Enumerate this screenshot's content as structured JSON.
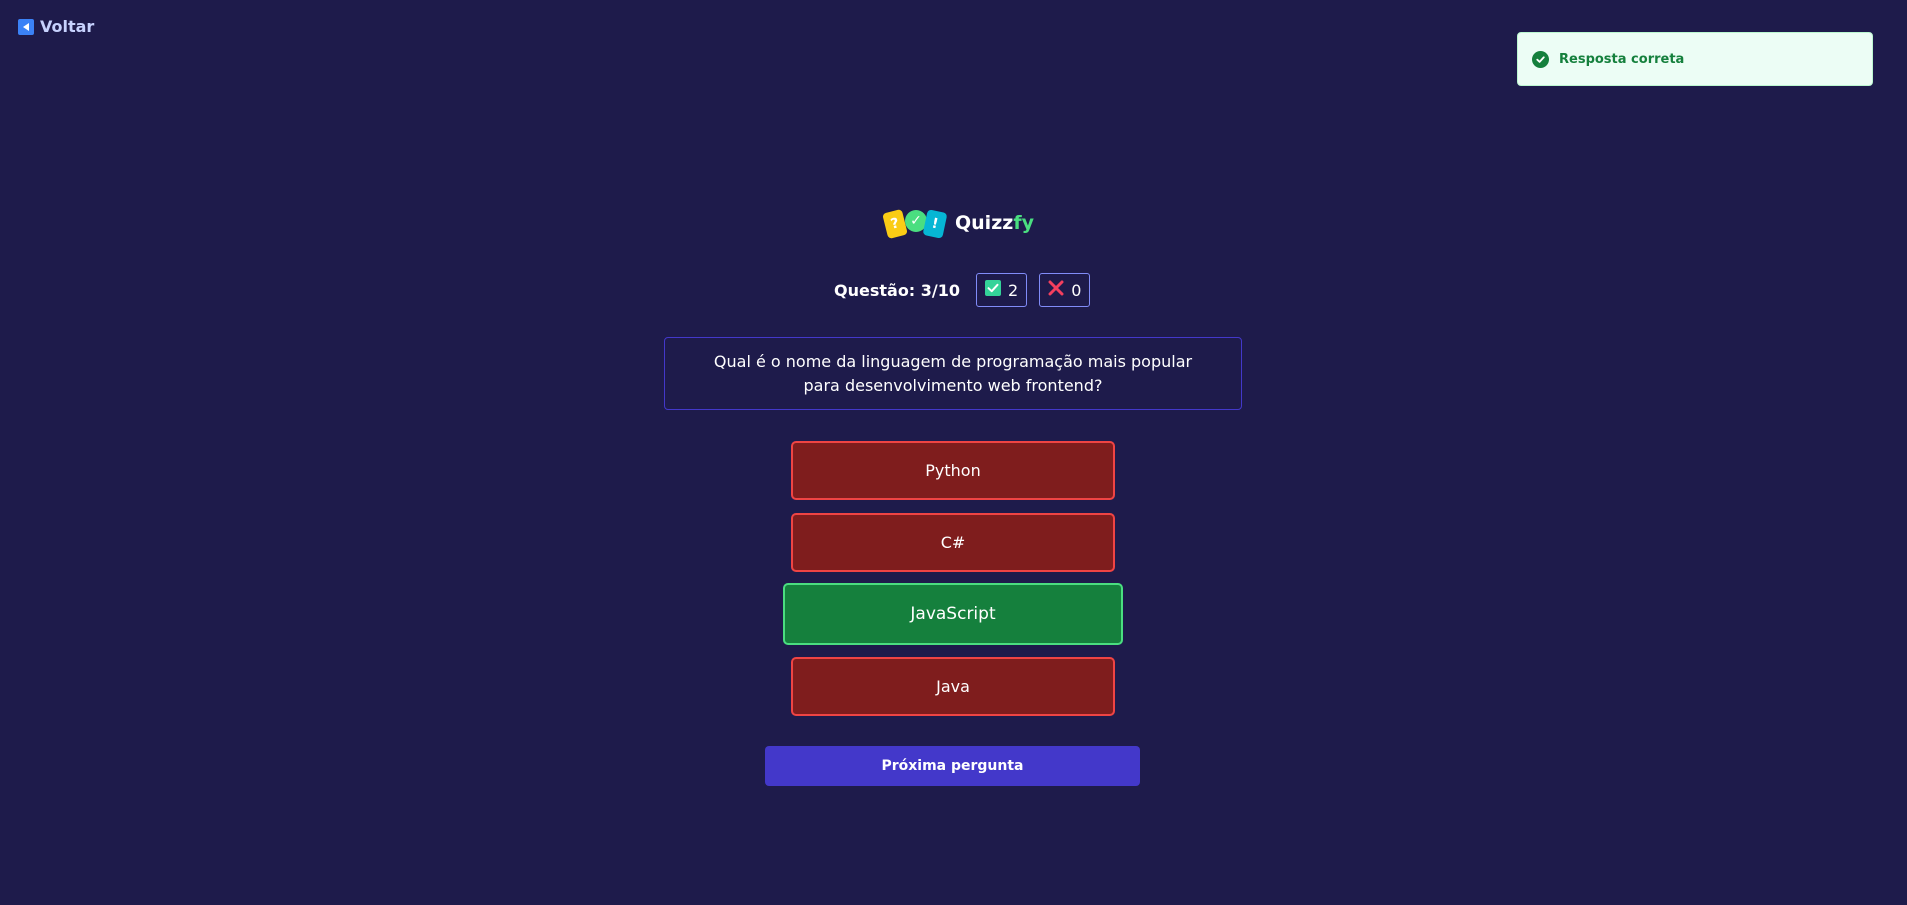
{
  "nav": {
    "back_label": "Voltar"
  },
  "toast": {
    "message": "Resposta correta",
    "icon": "check-circle-icon"
  },
  "logo": {
    "cards": [
      "?",
      "✓",
      "!"
    ],
    "name_main": "Quizz",
    "name_accent": "fy"
  },
  "stats": {
    "question_label": "Questão: 3/10",
    "correct_count": "2",
    "wrong_count": "0"
  },
  "question": {
    "text": "Qual é o nome da linguagem de programação mais popular para desenvolvimento web frontend?"
  },
  "answers": [
    {
      "label": "Python",
      "status": "wrong"
    },
    {
      "label": "C#",
      "status": "wrong"
    },
    {
      "label": "JavaScript",
      "status": "correct"
    },
    {
      "label": "Java",
      "status": "wrong"
    }
  ],
  "actions": {
    "next_label": "Próxima pergunta"
  },
  "colors": {
    "background": "#1e1b4b",
    "wrong": "#7f1d1d",
    "correct": "#15803d",
    "primary": "#4338ca",
    "toast_bg": "#ecfdf5"
  }
}
